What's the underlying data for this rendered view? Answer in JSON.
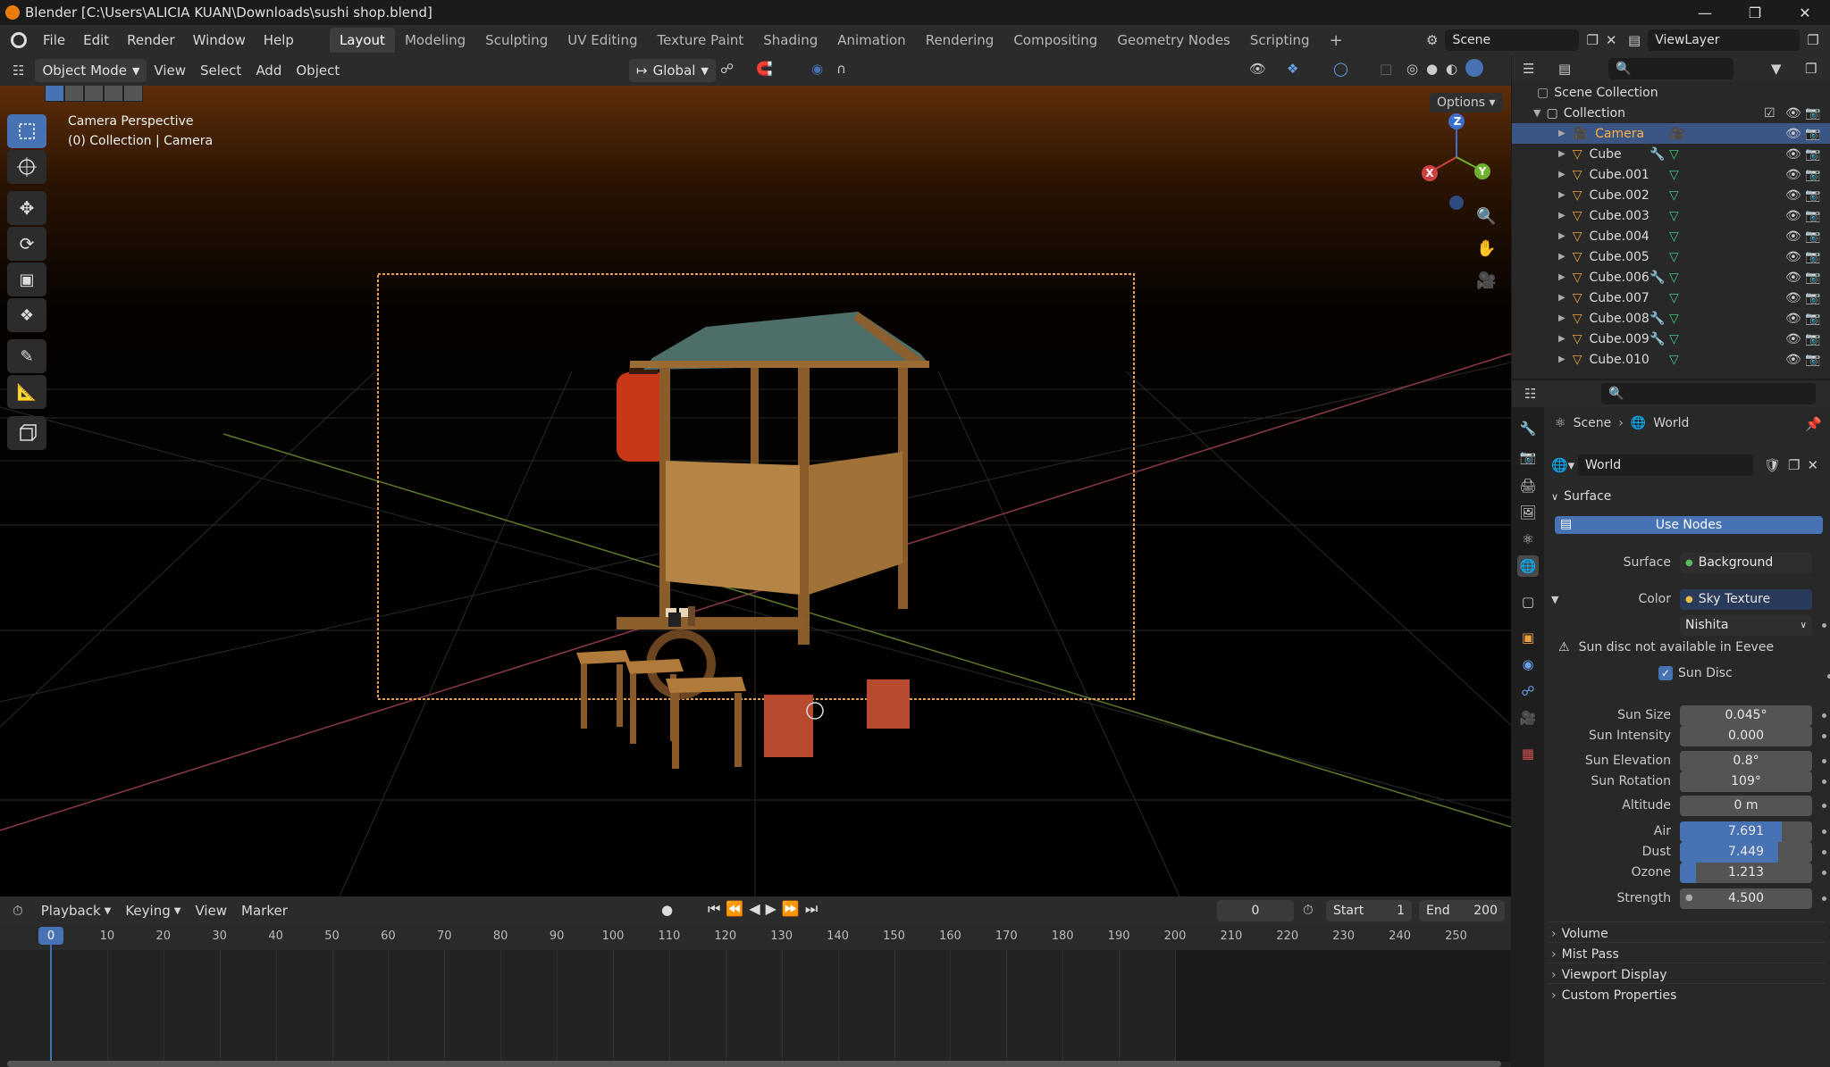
{
  "title": "Blender [C:\\Users\\ALICIA KUAN\\Downloads\\sushi shop.blend]",
  "menus": [
    "File",
    "Edit",
    "Render",
    "Window",
    "Help"
  ],
  "workspaces": [
    "Layout",
    "Modeling",
    "Sculpting",
    "UV Editing",
    "Texture Paint",
    "Shading",
    "Animation",
    "Rendering",
    "Compositing",
    "Geometry Nodes",
    "Scripting"
  ],
  "active_workspace": "Layout",
  "scene": {
    "name": "Scene"
  },
  "view_layer": {
    "name": "ViewLayer"
  },
  "viewport_header": {
    "mode": "Object Mode",
    "menus": [
      "View",
      "Select",
      "Add",
      "Object"
    ],
    "transform": "Global",
    "options": "Options"
  },
  "viewport": {
    "overlay_title": "Camera Perspective",
    "overlay_sub": "(0) Collection | Camera",
    "gizmo": {
      "x": "X",
      "y": "Y",
      "z": "Z"
    }
  },
  "outliner": {
    "root": "Scene Collection",
    "collection": "Collection",
    "items": [
      {
        "name": "Camera",
        "selected": true
      },
      {
        "name": "Cube",
        "mod": true
      },
      {
        "name": "Cube.001"
      },
      {
        "name": "Cube.002"
      },
      {
        "name": "Cube.003"
      },
      {
        "name": "Cube.004"
      },
      {
        "name": "Cube.005"
      },
      {
        "name": "Cube.006",
        "mod": true
      },
      {
        "name": "Cube.007"
      },
      {
        "name": "Cube.008",
        "mod": true
      },
      {
        "name": "Cube.009",
        "mod": true
      },
      {
        "name": "Cube.010"
      }
    ]
  },
  "properties": {
    "breadcrumb": [
      "Scene",
      "World"
    ],
    "world_name": "World",
    "surface_header": "Surface",
    "use_nodes": "Use Nodes",
    "surface_label": "Surface",
    "surface_value": "Background",
    "color_label": "Color",
    "color_value": "Sky Texture",
    "sky_type": "Nishita",
    "warning": "Sun disc not available in Eevee",
    "sun_disc": "Sun Disc",
    "fields": [
      {
        "label": "Sun Size",
        "value": "0.045°"
      },
      {
        "label": "Sun Intensity",
        "value": "0.000"
      },
      {
        "label": "Sun Elevation",
        "value": "0.8°"
      },
      {
        "label": "Sun Rotation",
        "value": "109°"
      },
      {
        "label": "Altitude",
        "value": "0 m"
      },
      {
        "label": "Air",
        "value": "7.691",
        "fill": 0.769
      },
      {
        "label": "Dust",
        "value": "7.449",
        "fill": 0.745
      },
      {
        "label": "Ozone",
        "value": "1.213",
        "fill": 0.121
      },
      {
        "label": "Strength",
        "value": "4.500"
      }
    ],
    "panels": [
      "Volume",
      "Mist Pass",
      "Viewport Display",
      "Custom Properties"
    ]
  },
  "timeline": {
    "menus": [
      "Playback",
      "Keying",
      "View",
      "Marker"
    ],
    "current_frame": "0",
    "start_label": "Start",
    "start": "1",
    "end_label": "End",
    "end": "200",
    "ticks": [
      "0",
      "10",
      "20",
      "30",
      "40",
      "50",
      "60",
      "70",
      "80",
      "90",
      "100",
      "110",
      "120",
      "130",
      "140",
      "150",
      "160",
      "170",
      "180",
      "190",
      "200",
      "210",
      "220",
      "230",
      "240",
      "250"
    ]
  },
  "colors": {
    "accent": "#4772b3",
    "selected_row": "#3b5585",
    "camera_frame": "#f0a040"
  }
}
